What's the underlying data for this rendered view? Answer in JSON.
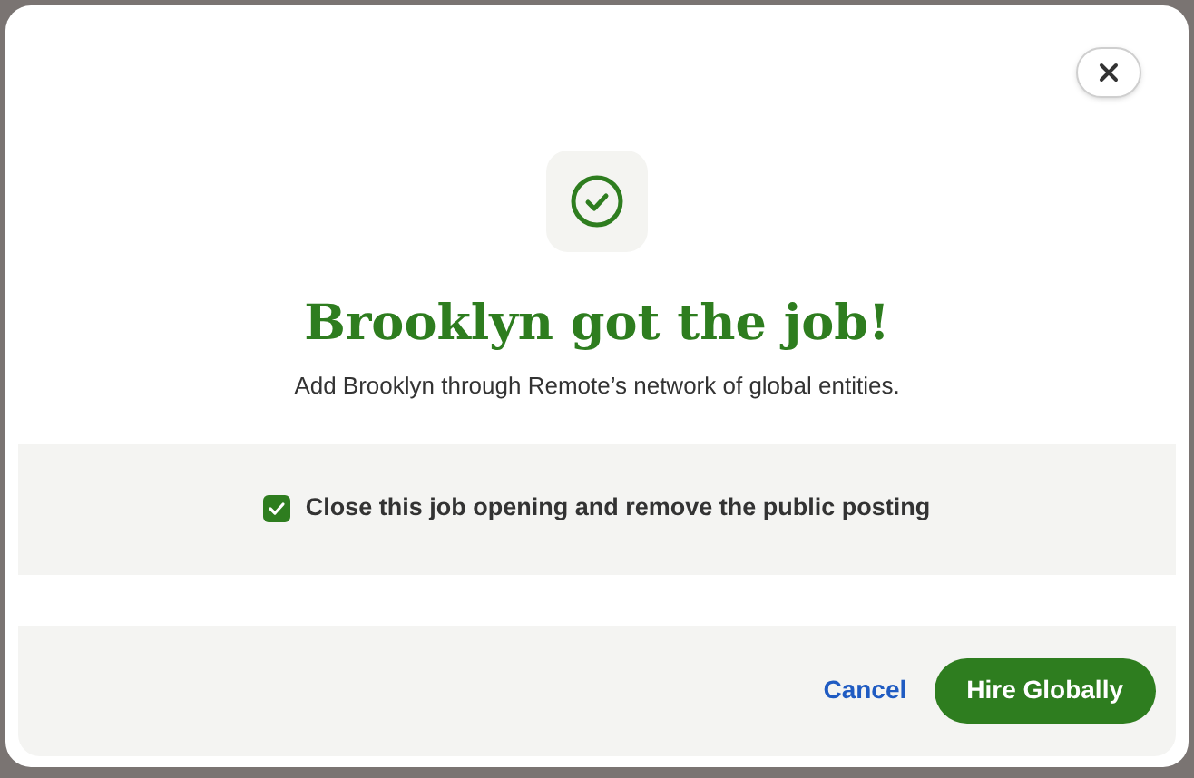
{
  "dialog": {
    "title": "Brooklyn got the job!",
    "subtitle": "Add Brooklyn through Remote’s network of global entities.",
    "option": {
      "label": "Close this job opening and remove the public posting",
      "checked": true
    },
    "buttons": [
      {
        "kind": "link",
        "label": "Cancel"
      },
      {
        "kind": "primary",
        "label": "Hire Globally"
      }
    ]
  }
}
